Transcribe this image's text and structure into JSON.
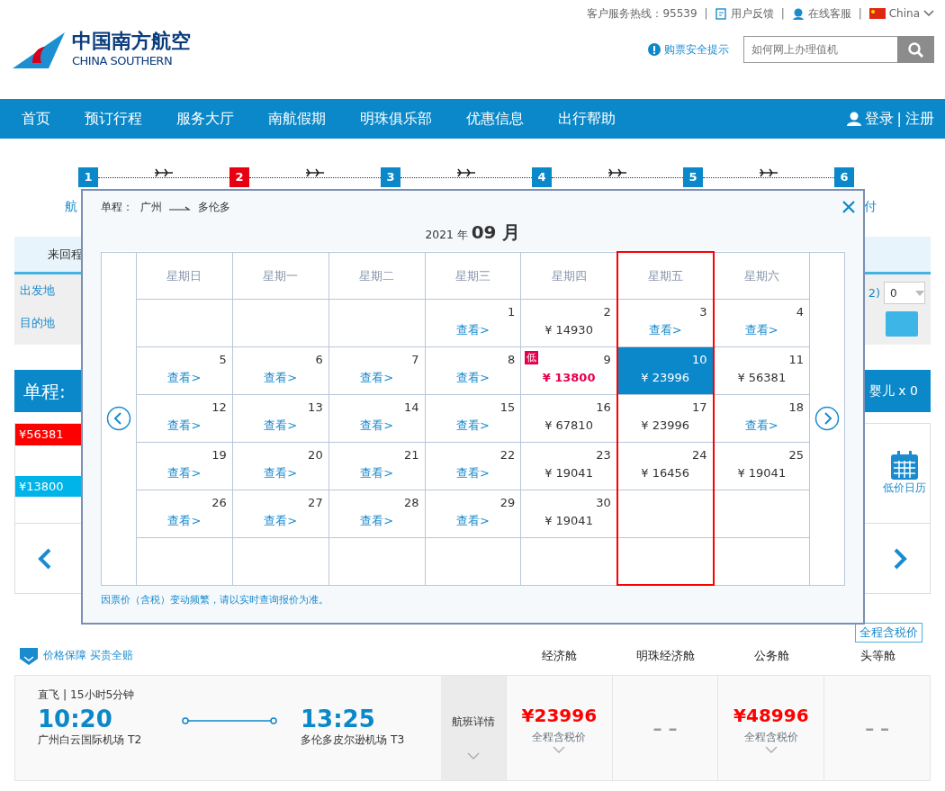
{
  "top_links": [
    {
      "kind": "hotline",
      "label": "客户服务热线：95539"
    },
    {
      "kind": "feedback",
      "label": "用户反馈",
      "sep": "|"
    },
    {
      "kind": "service",
      "label": "在线客服",
      "sep": "|"
    },
    {
      "kind": "region",
      "label": "China",
      "sep": "|"
    }
  ],
  "logo": {
    "cn": "中国南方航空",
    "en": "CHINA SOUTHERN"
  },
  "safety_tip": "购票安全提示",
  "search": {
    "placeholder": "如何网上办理值机"
  },
  "nav": [
    "首页",
    "预订行程",
    "服务大厅",
    "南航假期",
    "明珠俱乐部",
    "优惠信息",
    "出行帮助"
  ],
  "account": {
    "login": "登录",
    "sep": "|",
    "register": "注册"
  },
  "steps": [
    {
      "number": "1",
      "current": false
    },
    {
      "number": "2",
      "current": true
    },
    {
      "number": "3",
      "current": false
    },
    {
      "number": "4",
      "current": false
    },
    {
      "number": "5",
      "current": false
    },
    {
      "number": "6",
      "current": false
    }
  ],
  "step_label_left": "航",
  "step_label_right": "付",
  "trip_tab": "来回程",
  "form_labels": [
    "出发地",
    "目的地"
  ],
  "passenger_fragment": "2)",
  "passenger_select": "0",
  "route_bar": {
    "label": "单程:",
    "infant": "婴儿 x 0"
  },
  "price_tags": [
    {
      "text": "¥56381",
      "color": "#ff0000"
    },
    {
      "text": "¥13800",
      "color": "#00b4ea"
    }
  ],
  "low_price_calendar": "低价日历",
  "tax_link": "全程含税价",
  "guarantee": {
    "label": "价格保障",
    "highlight": "买贵全赔"
  },
  "cabins": [
    "经济舱",
    "明珠经济舱",
    "公务舱",
    "头等舱"
  ],
  "flight": {
    "info": "直飞 | 15小时5分钟",
    "dep_time": "10:20",
    "dep_airport": "广州白云国际机场 T2",
    "arr_time": "13:25",
    "arr_airport": "多伦多皮尔逊机场 T3",
    "details": "航班详情",
    "fares": [
      {
        "price": "¥23996",
        "note": "全程含税价"
      },
      {
        "price": "– –"
      },
      {
        "price": "¥48996",
        "note": "全程含税价"
      },
      {
        "price": "– –"
      }
    ]
  },
  "modal": {
    "route_label": "单程：",
    "from": "广州",
    "to": "多伦多",
    "year": "2021 年",
    "month": "09 月",
    "note": "因票价（含税）变动频繁，请以实时查询报价为准。",
    "weekdays": [
      {
        "label": "星期日",
        "highlighted": false
      },
      {
        "label": "星期一",
        "highlighted": false
      },
      {
        "label": "星期二",
        "highlighted": false
      },
      {
        "label": "星期三",
        "highlighted": false
      },
      {
        "label": "星期四",
        "highlighted": false
      },
      {
        "label": "星期五",
        "highlighted": true
      },
      {
        "label": "星期六",
        "highlighted": false
      }
    ],
    "weeks": [
      [
        {
          "kind": "empty"
        },
        {
          "kind": "empty"
        },
        {
          "kind": "empty"
        },
        {
          "kind": "link",
          "day": "1",
          "text": "查看>",
          "selected": false
        },
        {
          "kind": "price",
          "day": "2",
          "text": "¥ 14930",
          "selected": false
        },
        {
          "kind": "link",
          "day": "3",
          "text": "查看>",
          "selected": false
        },
        {
          "kind": "link",
          "day": "4",
          "text": "查看>",
          "selected": false
        }
      ],
      [
        {
          "kind": "link",
          "day": "5",
          "text": "查看>",
          "selected": false
        },
        {
          "kind": "link",
          "day": "6",
          "text": "查看>",
          "selected": false
        },
        {
          "kind": "link",
          "day": "7",
          "text": "查看>",
          "selected": false
        },
        {
          "kind": "link",
          "day": "8",
          "text": "查看>",
          "selected": false
        },
        {
          "kind": "lowest",
          "day": "9",
          "badge": "低",
          "text": "¥ 13800",
          "selected": false
        },
        {
          "kind": "price",
          "day": "10",
          "text": "¥ 23996",
          "selected": true
        },
        {
          "kind": "price",
          "day": "11",
          "text": "¥ 56381",
          "selected": false
        }
      ],
      [
        {
          "kind": "link",
          "day": "12",
          "text": "查看>",
          "selected": false
        },
        {
          "kind": "link",
          "day": "13",
          "text": "查看>",
          "selected": false
        },
        {
          "kind": "link",
          "day": "14",
          "text": "查看>",
          "selected": false
        },
        {
          "kind": "link",
          "day": "15",
          "text": "查看>",
          "selected": false
        },
        {
          "kind": "price",
          "day": "16",
          "text": "¥ 67810",
          "selected": false
        },
        {
          "kind": "price",
          "day": "17",
          "text": "¥ 23996",
          "selected": false
        },
        {
          "kind": "link",
          "day": "18",
          "text": "查看>",
          "selected": false
        }
      ],
      [
        {
          "kind": "link",
          "day": "19",
          "text": "查看>",
          "selected": false
        },
        {
          "kind": "link",
          "day": "20",
          "text": "查看>",
          "selected": false
        },
        {
          "kind": "link",
          "day": "21",
          "text": "查看>",
          "selected": false
        },
        {
          "kind": "link",
          "day": "22",
          "text": "查看>",
          "selected": false
        },
        {
          "kind": "price",
          "day": "23",
          "text": "¥ 19041",
          "selected": false
        },
        {
          "kind": "price",
          "day": "24",
          "text": "¥ 16456",
          "selected": false
        },
        {
          "kind": "price",
          "day": "25",
          "text": "¥ 19041",
          "selected": false
        }
      ],
      [
        {
          "kind": "link",
          "day": "26",
          "text": "查看>",
          "selected": false
        },
        {
          "kind": "link",
          "day": "27",
          "text": "查看>",
          "selected": false
        },
        {
          "kind": "link",
          "day": "28",
          "text": "查看>",
          "selected": false
        },
        {
          "kind": "link",
          "day": "29",
          "text": "查看>",
          "selected": false
        },
        {
          "kind": "price",
          "day": "30",
          "text": "¥ 19041",
          "selected": false
        },
        {
          "kind": "empty"
        },
        {
          "kind": "empty"
        }
      ],
      [
        {
          "kind": "empty"
        },
        {
          "kind": "empty"
        },
        {
          "kind": "empty"
        },
        {
          "kind": "empty"
        },
        {
          "kind": "empty"
        },
        {
          "kind": "empty"
        },
        {
          "kind": "empty"
        }
      ]
    ]
  }
}
